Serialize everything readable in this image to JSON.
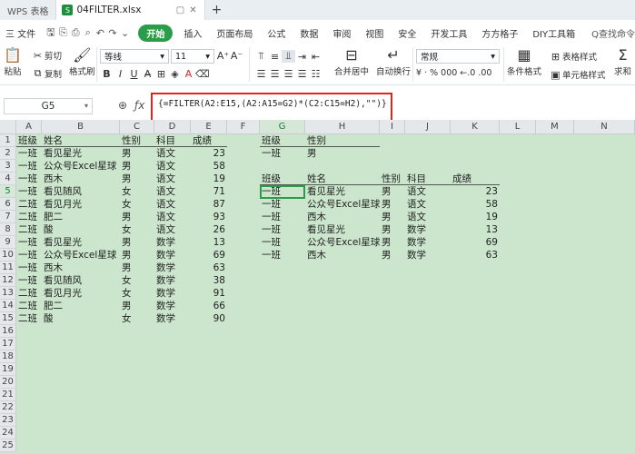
{
  "titlebar": {
    "app_tab": "WPS 表格",
    "file_name": "04FILTER.xlsx"
  },
  "menubar": {
    "file_menu": "三 文件",
    "start": "开始",
    "items": [
      "插入",
      "页面布局",
      "公式",
      "数据",
      "审阅",
      "视图",
      "安全",
      "开发工具",
      "方方格子",
      "DIY工具箱"
    ],
    "search": "Q查找命令"
  },
  "ribbon": {
    "cut": "剪切",
    "paste": "粘贴",
    "copy": "复制",
    "format_painter": "格式刷",
    "font_name": "等线",
    "font_size": "11",
    "merge_center": "合并居中",
    "wrap_text": "自动换行",
    "number_format": "常规",
    "percent_symbols": "¥ · % 000 ←.0 .00",
    "cond_format": "条件格式",
    "table_style": "表格样式",
    "cell_style": "单元格样式",
    "sum": "求和"
  },
  "formula_bar": {
    "name_box": "G5",
    "formula": "{=FILTER(A2:E15,(A2:A15=G2)*(C2:C15=H2),\"\")}"
  },
  "sheet": {
    "columns": [
      "A",
      "B",
      "C",
      "D",
      "E",
      "F",
      "G",
      "H",
      "I",
      "J",
      "K",
      "L",
      "M",
      "N"
    ],
    "rows": [
      "1",
      "2",
      "3",
      "4",
      "5",
      "6",
      "7",
      "8",
      "9",
      "10",
      "11",
      "12",
      "13",
      "14",
      "15",
      "16",
      "17",
      "18",
      "19",
      "20",
      "21",
      "22",
      "23",
      "24",
      "25"
    ],
    "source_header": [
      "班级",
      "姓名",
      "性别",
      "科目",
      "成绩"
    ],
    "source_rows": [
      [
        "一班",
        "看见星光",
        "男",
        "语文",
        "23"
      ],
      [
        "一班",
        "公众号Excel星球",
        "男",
        "语文",
        "58"
      ],
      [
        "一班",
        "西木",
        "男",
        "语文",
        "19"
      ],
      [
        "一班",
        "看见随风",
        "女",
        "语文",
        "71"
      ],
      [
        "二班",
        "看见月光",
        "女",
        "语文",
        "87"
      ],
      [
        "二班",
        "肥二",
        "男",
        "语文",
        "93"
      ],
      [
        "二班",
        "酸",
        "女",
        "语文",
        "26"
      ],
      [
        "一班",
        "看见星光",
        "男",
        "数学",
        "13"
      ],
      [
        "一班",
        "公众号Excel星球",
        "男",
        "数学",
        "69"
      ],
      [
        "一班",
        "西木",
        "男",
        "数学",
        "63"
      ],
      [
        "一班",
        "看见随风",
        "女",
        "数学",
        "38"
      ],
      [
        "二班",
        "看见月光",
        "女",
        "数学",
        "91"
      ],
      [
        "二班",
        "肥二",
        "男",
        "数学",
        "66"
      ],
      [
        "二班",
        "酸",
        "女",
        "数学",
        "90"
      ]
    ],
    "criteria_header": [
      "班级",
      "性别"
    ],
    "criteria_values": [
      "一班",
      "男"
    ],
    "result_header": [
      "班级",
      "姓名",
      "性别",
      "科目",
      "成绩"
    ],
    "result_rows": [
      [
        "一班",
        "看见星光",
        "男",
        "语文",
        "23"
      ],
      [
        "一班",
        "公众号Excel星球",
        "男",
        "语文",
        "58"
      ],
      [
        "一班",
        "西木",
        "男",
        "语文",
        "19"
      ],
      [
        "一班",
        "看见星光",
        "男",
        "数学",
        "13"
      ],
      [
        "一班",
        "公众号Excel星球",
        "男",
        "数学",
        "69"
      ],
      [
        "一班",
        "西木",
        "男",
        "数学",
        "63"
      ]
    ]
  }
}
